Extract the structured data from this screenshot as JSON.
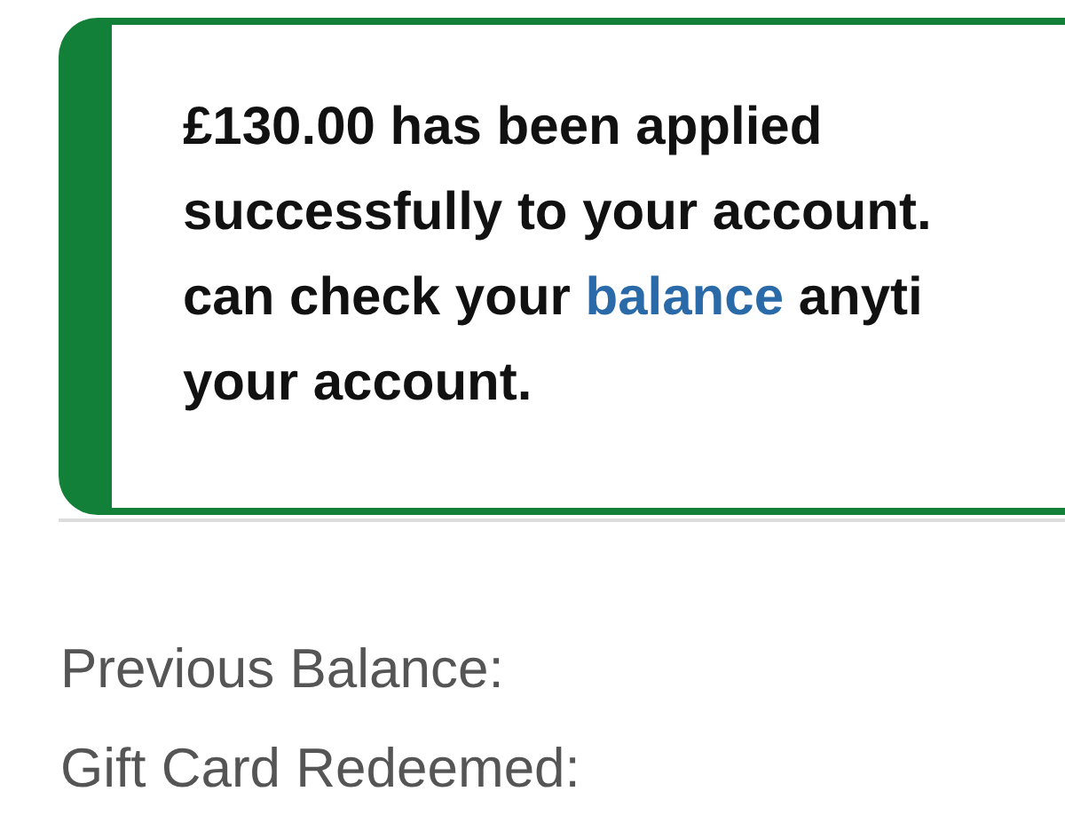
{
  "alert": {
    "lines": [
      {
        "text": "£130.00 has been applied"
      },
      {
        "text": "successfully to your account."
      },
      {
        "text": "can check your ",
        "link": "balance",
        "after": " anyti"
      },
      {
        "text": "your account."
      }
    ]
  },
  "summary": {
    "rows": [
      {
        "label": "Previous Balance:"
      },
      {
        "label": "Gift Card Redeemed:"
      }
    ]
  }
}
